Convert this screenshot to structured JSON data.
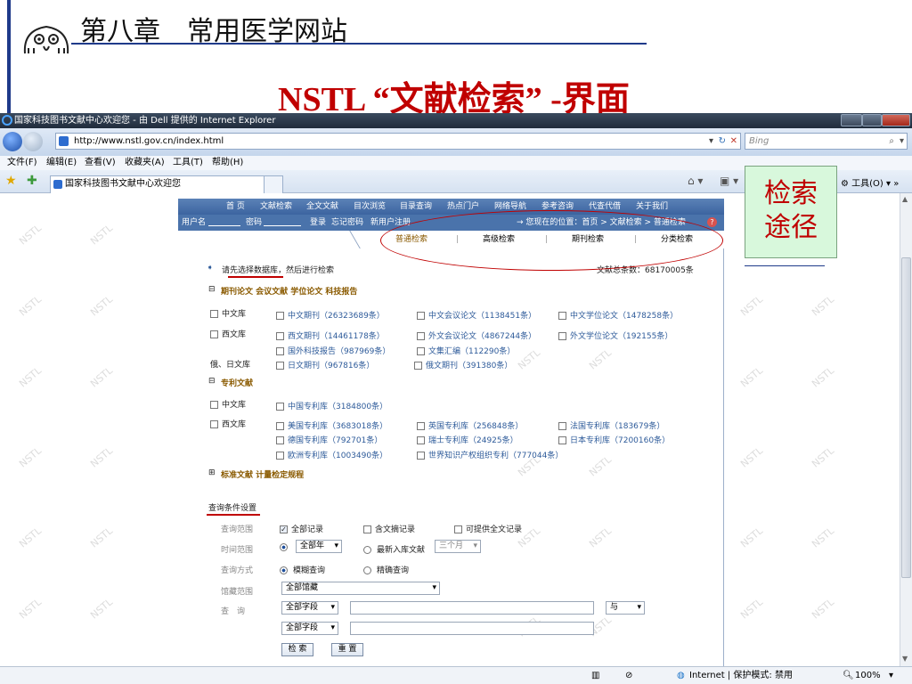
{
  "slide": {
    "chapter": "第八章　常用医学网站",
    "title": "NSTL “文献检索” -界面",
    "callout": [
      "检索",
      "途径"
    ]
  },
  "browser": {
    "window_title": "国家科技图书文献中心欢迎您 - 由 Dell 提供的 Internet Explorer",
    "url": "http://www.nstl.gov.cn/index.html",
    "search_placeholder": "Bing",
    "menu": [
      "文件(F)",
      "编辑(E)",
      "查看(V)",
      "收藏夹(A)",
      "工具(T)",
      "帮助(H)"
    ],
    "tab_title": "国家科技图书文献中心欢迎您",
    "tools_label": "工具(O)",
    "status": {
      "zone": "Internet | 保护模式: 禁用",
      "zoom": "100%"
    }
  },
  "site": {
    "watermark": "NSTL",
    "nav": [
      "首 页",
      "文献检索",
      "全文文献",
      "目次浏览",
      "目录查询",
      "热点门户",
      "网络导航",
      "参考咨询",
      "代查代借",
      "关于我们"
    ],
    "userbar": {
      "username_label": "用户名",
      "password_label": "密码",
      "login": "登录",
      "forgot": "忘记密码",
      "register": "新用户注册",
      "location": "→ 您现在的位置：首页 > 文献检索 > 普通检索"
    },
    "search_tabs": [
      "普通检索",
      "高级检索",
      "期刊检索",
      "分类检索"
    ],
    "prompt": "请先选择数据库，然后进行检索",
    "total_count": "文献总条数：68170005条",
    "sections": {
      "journals": "期刊论文 会议文献 学位论文 科技报告",
      "patents": "专利文献",
      "standards": "标准文献 计量检定规程"
    },
    "lib_labels": {
      "chinese": "中文库",
      "western": "西文库",
      "ru_jp": "俄、日文库"
    },
    "journal_dbs": {
      "cn_journal": "中文期刊（26323689条）",
      "cn_conf": "中文会议论文（1138451条）",
      "cn_thesis": "中文学位论文（1478258条）",
      "west_journal": "西文期刊（14461178条）",
      "foreign_conf": "外文会议论文（4867244条）",
      "foreign_thesis": "外文学位论文（192155条）",
      "foreign_report": "国外科技报告（987969条）",
      "proceedings": "文集汇编（112290条）",
      "jp_journal": "日文期刊（967816条）",
      "ru_journal": "俄文期刊（391380条）"
    },
    "patent_dbs": {
      "cn": "中国专利库（3184800条）",
      "us": "美国专利库（3683018条）",
      "uk": "英国专利库（256848条）",
      "fr": "法国专利库（183679条）",
      "de": "德国专利库（792701条）",
      "ch": "瑞士专利库（24925条）",
      "jp": "日本专利库（7200160条）",
      "eu": "欧洲专利库（1003490条）",
      "wipo": "世界知识产权组织专利（777044条）"
    },
    "query": {
      "heading": "查询条件设置",
      "scope_label": "查询范围",
      "scope_all": "全部记录",
      "scope_abstract": "含文摘记录",
      "scope_fulltext": "可提供全文记录",
      "time_label": "时间范围",
      "time_all": "全部年",
      "time_latest": "最新入库文献",
      "time_months": "三个月",
      "mode_label": "查询方式",
      "mode_fuzzy": "模糊查询",
      "mode_exact": "精确查询",
      "holding_label": "馆藏范围",
      "holding_value": "全部馆藏",
      "query_label": "查　询",
      "field1": "全部字段",
      "bool": "与",
      "field2": "全部字段",
      "search_btn": "检 索",
      "reset_btn": "重 置"
    }
  }
}
